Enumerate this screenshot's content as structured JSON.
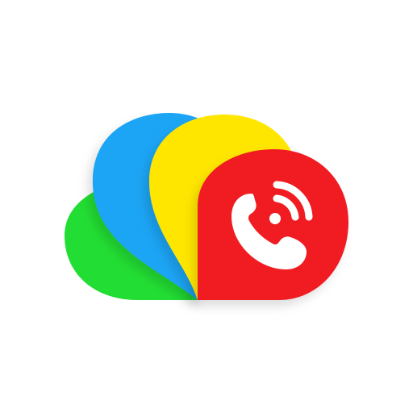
{
  "app_icon": {
    "description_name": "cloud-call-logo",
    "colors": {
      "background": "#ffffff",
      "green": "#22dd33",
      "blue": "#1ba5f5",
      "yellow": "#ffe600",
      "red": "#f01c24",
      "glyph": "#ffffff",
      "shadow": "#000000"
    },
    "icons": [
      "cloud-icon",
      "phone-icon",
      "signal-waves-icon"
    ]
  }
}
